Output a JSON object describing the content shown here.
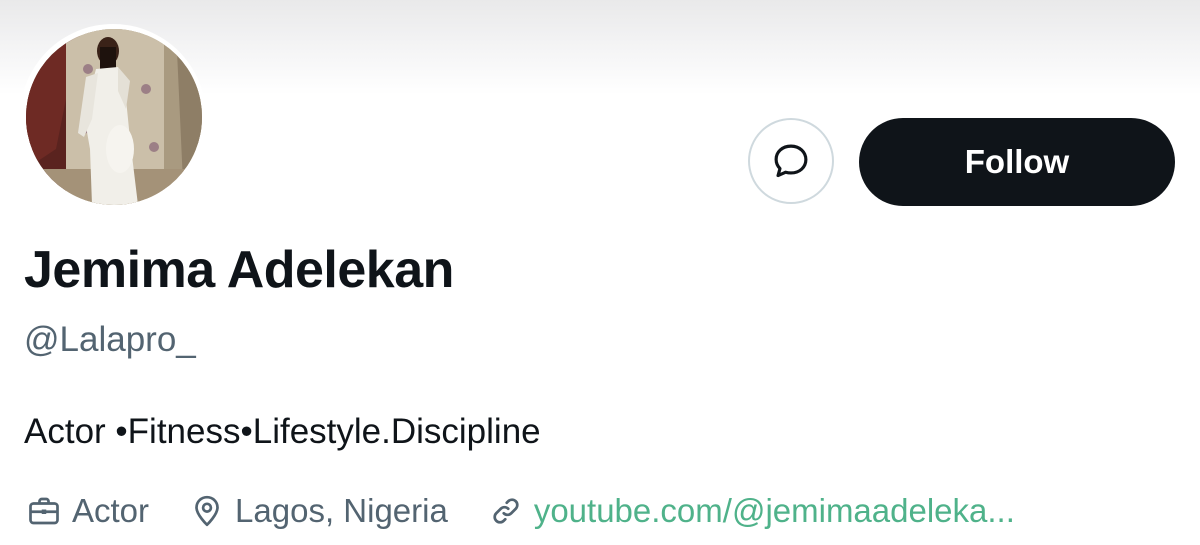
{
  "profile": {
    "display_name": "Jemima Adelekan",
    "handle": "@Lalapro_",
    "bio": "Actor •Fitness•Lifestyle.Discipline",
    "avatar_icon": "profile-photo"
  },
  "actions": {
    "message_icon": "message-bubble-icon",
    "follow_label": "Follow"
  },
  "meta": {
    "profession": "Actor",
    "location": "Lagos, Nigeria",
    "website": "youtube.com/@jemimaadeleka..."
  },
  "colors": {
    "text_primary": "#0f1419",
    "text_secondary": "#536471",
    "link": "#4fb28a",
    "follow_bg": "#0f1419",
    "follow_text": "#ffffff",
    "border": "#cfd9de"
  }
}
